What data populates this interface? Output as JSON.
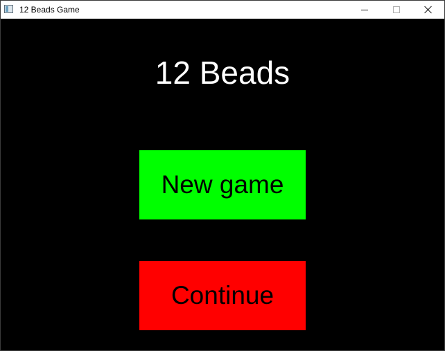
{
  "window": {
    "title": "12 Beads Game"
  },
  "screen": {
    "heading": "12 Beads",
    "buttons": {
      "new_game": "New game",
      "continue": "Continue"
    }
  },
  "colors": {
    "background": "#000000",
    "new_game": "#00ff00",
    "continue": "#ff0000",
    "heading": "#ffffff"
  },
  "icons": {
    "app": "app-window-icon",
    "minimize": "minimize-icon",
    "maximize": "maximize-icon",
    "close": "close-icon"
  }
}
